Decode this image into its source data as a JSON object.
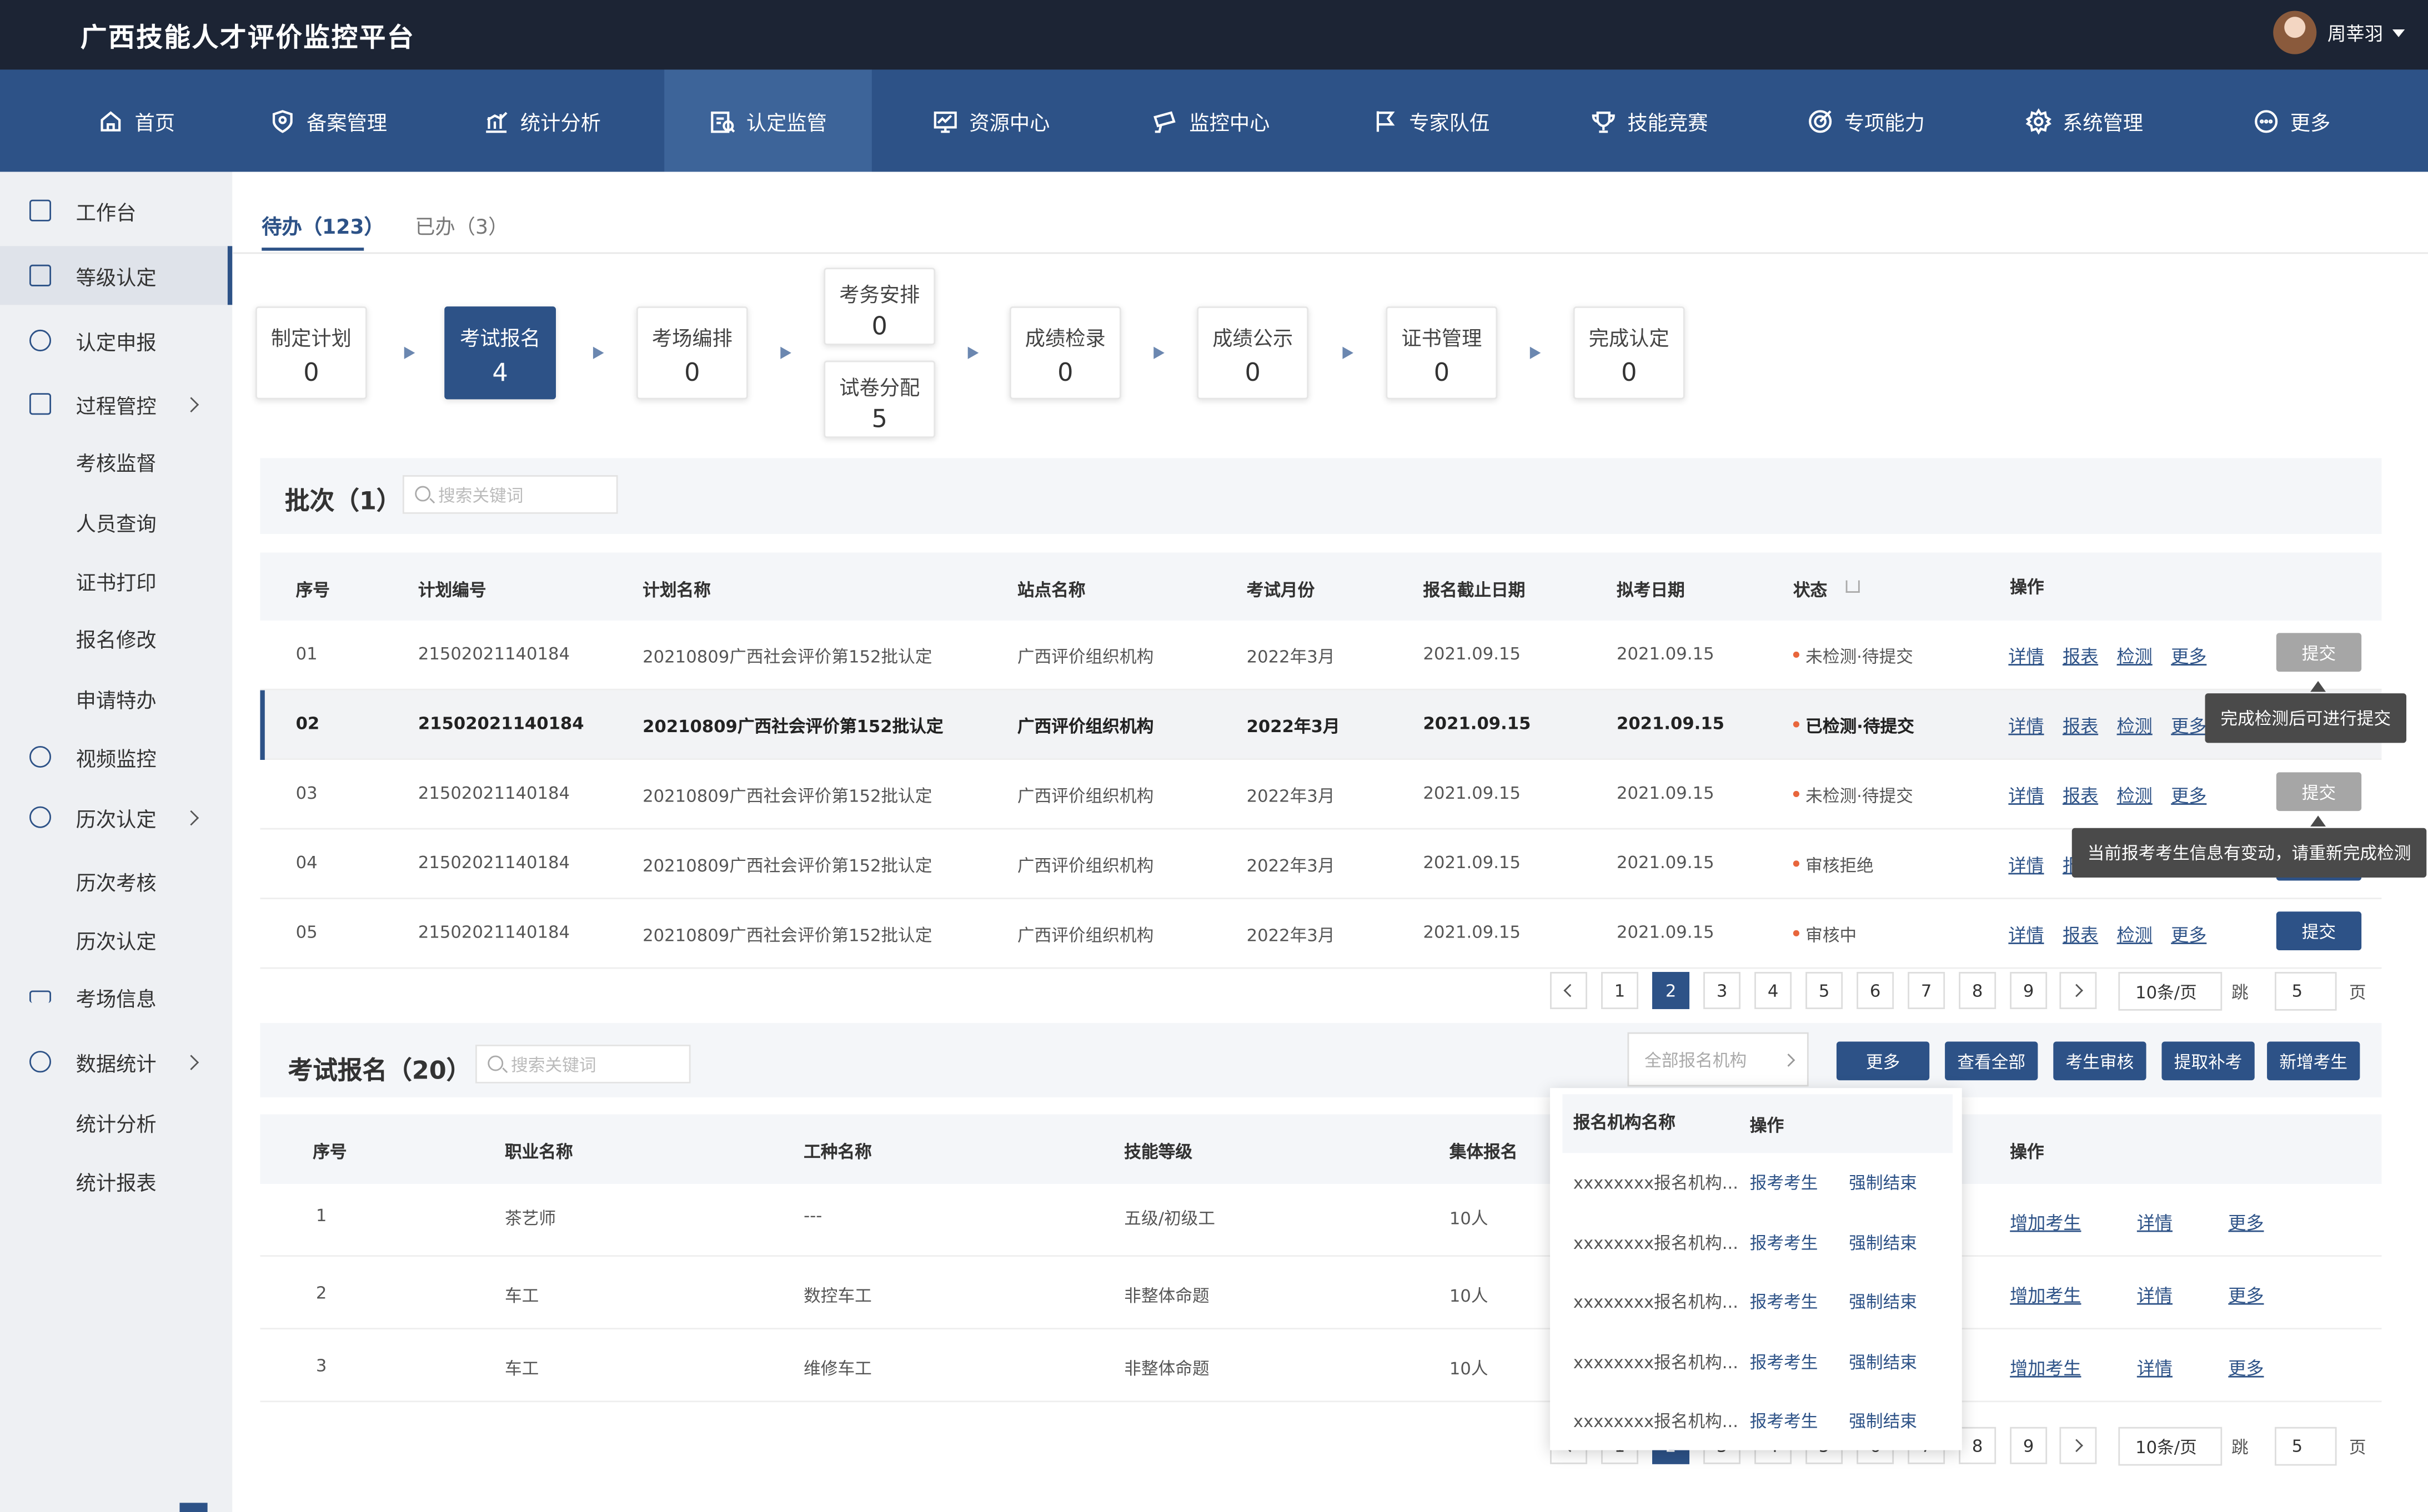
{
  "header": {
    "title": "广西技能人才评价监控平台",
    "user": "周莘羽"
  },
  "nav": [
    {
      "label": "首页",
      "icon": "home-icon"
    },
    {
      "label": "备案管理",
      "icon": "record-icon"
    },
    {
      "label": "统计分析",
      "icon": "chart-icon"
    },
    {
      "label": "认定监管",
      "icon": "certify-icon"
    },
    {
      "label": "资源中心",
      "icon": "monitor-icon"
    },
    {
      "label": "监控中心",
      "icon": "camera-icon"
    },
    {
      "label": "专家队伍",
      "icon": "flag-icon"
    },
    {
      "label": "技能竞赛",
      "icon": "trophy-icon"
    },
    {
      "label": "专项能力",
      "icon": "target-icon"
    },
    {
      "label": "系统管理",
      "icon": "gear-icon"
    },
    {
      "label": "更多",
      "icon": "more-icon"
    }
  ],
  "sidebar": {
    "items": [
      {
        "label": "工作台"
      },
      {
        "label": "等级认定"
      },
      {
        "label": "认定申报"
      },
      {
        "label": "过程管控"
      },
      {
        "label": "视频监控"
      },
      {
        "label": "历次认定"
      },
      {
        "label": "考场信息"
      },
      {
        "label": "数据统计"
      }
    ],
    "subs": [
      "考核监督",
      "人员查询",
      "证书打印",
      "报名修改",
      "申请特办",
      "历次考核",
      "历次认定",
      "统计分析",
      "统计报表"
    ]
  },
  "tabs": {
    "todo": "待办（123）",
    "done": "已办（3）"
  },
  "steps": [
    {
      "name": "制定计划",
      "value": "0"
    },
    {
      "name": "考试报名",
      "value": "4"
    },
    {
      "name": "考场编排",
      "value": "0"
    },
    {
      "name": "考务安排",
      "value": "0"
    },
    {
      "name": "试卷分配",
      "value": "5"
    },
    {
      "name": "成绩检录",
      "value": "0"
    },
    {
      "name": "成绩公示",
      "value": "0"
    },
    {
      "name": "证书管理",
      "value": "0"
    },
    {
      "name": "完成认定",
      "value": "0"
    }
  ],
  "batch": {
    "title": "批次（1）",
    "search_placeholder": "搜索关键词",
    "headers": [
      "序号",
      "计划编号",
      "计划名称",
      "站点名称",
      "考试月份",
      "报名截止日期",
      "拟考日期",
      "状态",
      "操作"
    ],
    "rows": [
      {
        "no": "01",
        "code": "21502021140184",
        "name": "20210809广西社会评价第152批认定",
        "site": "广西评价组织机构",
        "month": "2022年3月",
        "deadline": "2021.09.15",
        "date": "2021.09.15",
        "status": "未检测·待提交"
      },
      {
        "no": "02",
        "code": "21502021140184",
        "name": "20210809广西社会评价第152批认定",
        "site": "广西评价组织机构",
        "month": "2022年3月",
        "deadline": "2021.09.15",
        "date": "2021.09.15",
        "status": "已检测·待提交"
      },
      {
        "no": "03",
        "code": "21502021140184",
        "name": "20210809广西社会评价第152批认定",
        "site": "广西评价组织机构",
        "month": "2022年3月",
        "deadline": "2021.09.15",
        "date": "2021.09.15",
        "status": "未检测·待提交"
      },
      {
        "no": "04",
        "code": "21502021140184",
        "name": "20210809广西社会评价第152批认定",
        "site": "广西评价组织机构",
        "month": "2022年3月",
        "deadline": "2021.09.15",
        "date": "2021.09.15",
        "status": "审核拒绝"
      },
      {
        "no": "05",
        "code": "21502021140184",
        "name": "20210809广西社会评价第152批认定",
        "site": "广西评价组织机构",
        "month": "2022年3月",
        "deadline": "2021.09.15",
        "date": "2021.09.15",
        "status": "审核中"
      }
    ],
    "ops": {
      "detail": "详情",
      "report": "报表",
      "check": "检测",
      "more": "更多",
      "submit": "提交"
    },
    "tip1": "完成检测后可进行提交",
    "tip2": "当前报考考生信息有变动，请重新完成检测"
  },
  "pager": {
    "pages": [
      "1",
      "2",
      "3",
      "4",
      "5",
      "6",
      "7",
      "8",
      "9"
    ],
    "per_page": "10条/页",
    "jump": "跳",
    "jump_value": "5",
    "page_unit": "页"
  },
  "enroll": {
    "title": "考试报名（20）",
    "search_placeholder": "搜索关键词",
    "org_select": "全部报名机构",
    "buttons": [
      "更多",
      "查看全部",
      "考生审核",
      "提取补考",
      "新增考生"
    ],
    "headers": [
      "序号",
      "职业名称",
      "工种名称",
      "技能等级",
      "集体报名",
      "操作"
    ],
    "rows": [
      {
        "no": "1",
        "job": "茶艺师",
        "type": "---",
        "level": "五级/初级工",
        "group": "10人"
      },
      {
        "no": "2",
        "job": "车工",
        "type": "数控车工",
        "level": "非整体命题",
        "group": "10人"
      },
      {
        "no": "3",
        "job": "车工",
        "type": "维修车工",
        "level": "非整体命题",
        "group": "10人"
      }
    ],
    "ops": {
      "add": "增加考生",
      "detail": "详情",
      "more": "更多"
    },
    "pager_tail": [
      "8",
      "9"
    ]
  },
  "dropdown": {
    "headers": [
      "报名机构名称",
      "操作"
    ],
    "rows": [
      {
        "org": "xxxxxxxx报名机构...",
        "a": "报考考生",
        "b": "强制结束"
      },
      {
        "org": "xxxxxxxx报名机构...",
        "a": "报考考生",
        "b": "强制结束"
      },
      {
        "org": "xxxxxxxx报名机构...",
        "a": "报考考生",
        "b": "强制结束"
      },
      {
        "org": "xxxxxxxx报名机构...",
        "a": "报考考生",
        "b": "强制结束"
      },
      {
        "org": "xxxxxxxx报名机构...",
        "a": "报考考生",
        "b": "强制结束"
      }
    ]
  },
  "colors": {
    "primary": "#2d5287",
    "topbar": "#1c2434",
    "status_dot": "#e8663c"
  }
}
